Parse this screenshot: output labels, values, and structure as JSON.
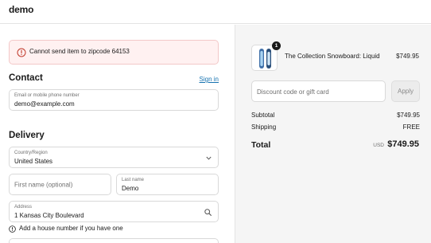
{
  "header": {
    "logo": "demo"
  },
  "error": {
    "message": "Cannot send item to zipcode 64153"
  },
  "contact": {
    "title": "Contact",
    "signin_label": "Sign in",
    "email_label": "Email or mobile phone number",
    "email_value": "demo@example.com"
  },
  "delivery": {
    "title": "Delivery",
    "country_label": "Country/Region",
    "country_value": "United States",
    "first_name_placeholder": "First name (optional)",
    "last_name_label": "Last name",
    "last_name_value": "Demo",
    "address_label": "Address",
    "address_value": "1 Kansas City Boulevard",
    "address_hint": "Add a house number if you have one"
  },
  "summary": {
    "product": {
      "name": "The Collection Snowboard: Liquid",
      "price": "$749.95",
      "quantity": "1"
    },
    "discount_placeholder": "Discount code or gift card",
    "apply_label": "Apply",
    "subtotal_label": "Subtotal",
    "subtotal_value": "$749.95",
    "shipping_label": "Shipping",
    "shipping_value": "FREE",
    "total_label": "Total",
    "total_currency": "USD",
    "total_value": "$749.95"
  },
  "colors": {
    "link": "#1773b0",
    "error_bg": "#fff1f1",
    "error_icon": "#c0392b",
    "summary_bg": "#f5f5f5"
  }
}
